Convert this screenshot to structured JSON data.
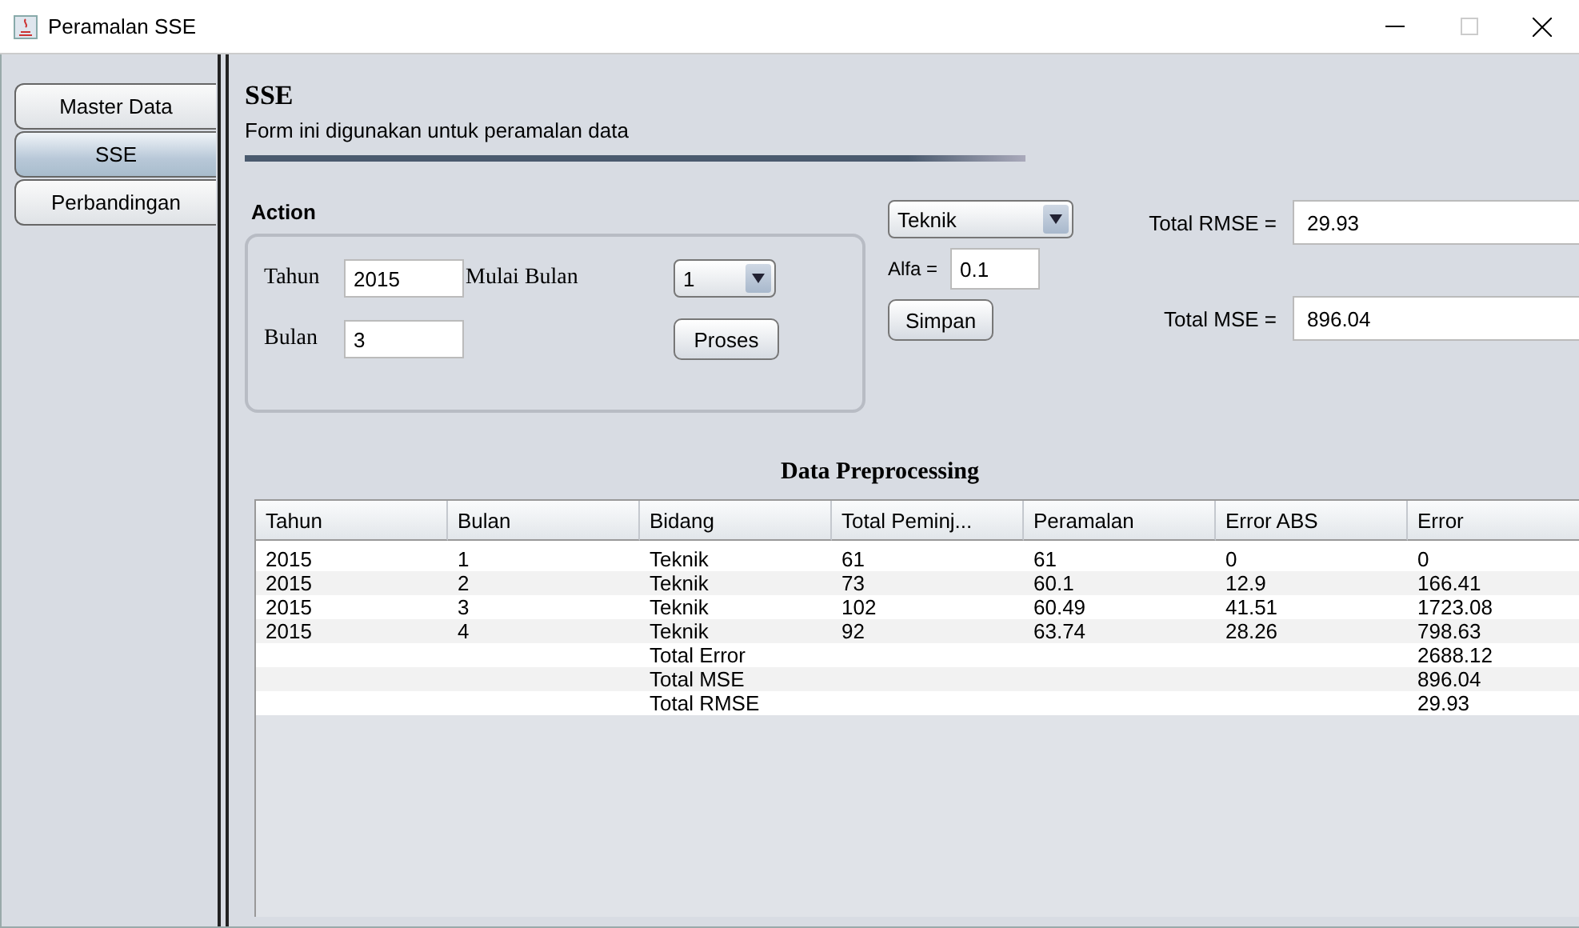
{
  "window": {
    "title": "Peramalan SSE"
  },
  "tabs": [
    {
      "label": "Master Data",
      "selected": false
    },
    {
      "label": "SSE",
      "selected": true
    },
    {
      "label": "Perbandingan",
      "selected": false
    }
  ],
  "header": {
    "title": "SSE",
    "subtitle": "Form ini digunakan untuk peramalan data"
  },
  "action": {
    "title": "Action",
    "tahun_label": "Tahun",
    "tahun_value": "2015",
    "bulan_label": "Bulan",
    "bulan_value": "3",
    "mulai_label": "Mulai Bulan",
    "mulai_value": "1",
    "proses_button": "Proses"
  },
  "bidang_dropdown": {
    "value": "Teknik"
  },
  "alfa": {
    "label": "Alfa =",
    "value": "0.1"
  },
  "simpan_button": "Simpan",
  "results": [
    {
      "label": "Total RMSE =",
      "value": "29.93"
    },
    {
      "label": "Total MSE =",
      "value": "896.04"
    }
  ],
  "table": {
    "title": "Data Preprocessing",
    "columns": [
      "Tahun",
      "Bulan",
      "Bidang",
      "Total Peminj...",
      "Peramalan",
      "Error ABS",
      "Error"
    ],
    "rows": [
      [
        "2015",
        "1",
        "Teknik",
        "61",
        "61",
        "0",
        "0"
      ],
      [
        "2015",
        "2",
        "Teknik",
        "73",
        "60.1",
        "12.9",
        "166.41"
      ],
      [
        "2015",
        "3",
        "Teknik",
        "102",
        "60.49",
        "41.51",
        "1723.08"
      ],
      [
        "2015",
        "4",
        "Teknik",
        "92",
        "63.74",
        "28.26",
        "798.63"
      ]
    ],
    "totals": [
      {
        "label": "Total Error",
        "value": "2688.12"
      },
      {
        "label": "Total MSE",
        "value": "896.04"
      },
      {
        "label": "Total RMSE",
        "value": "29.93"
      }
    ]
  }
}
